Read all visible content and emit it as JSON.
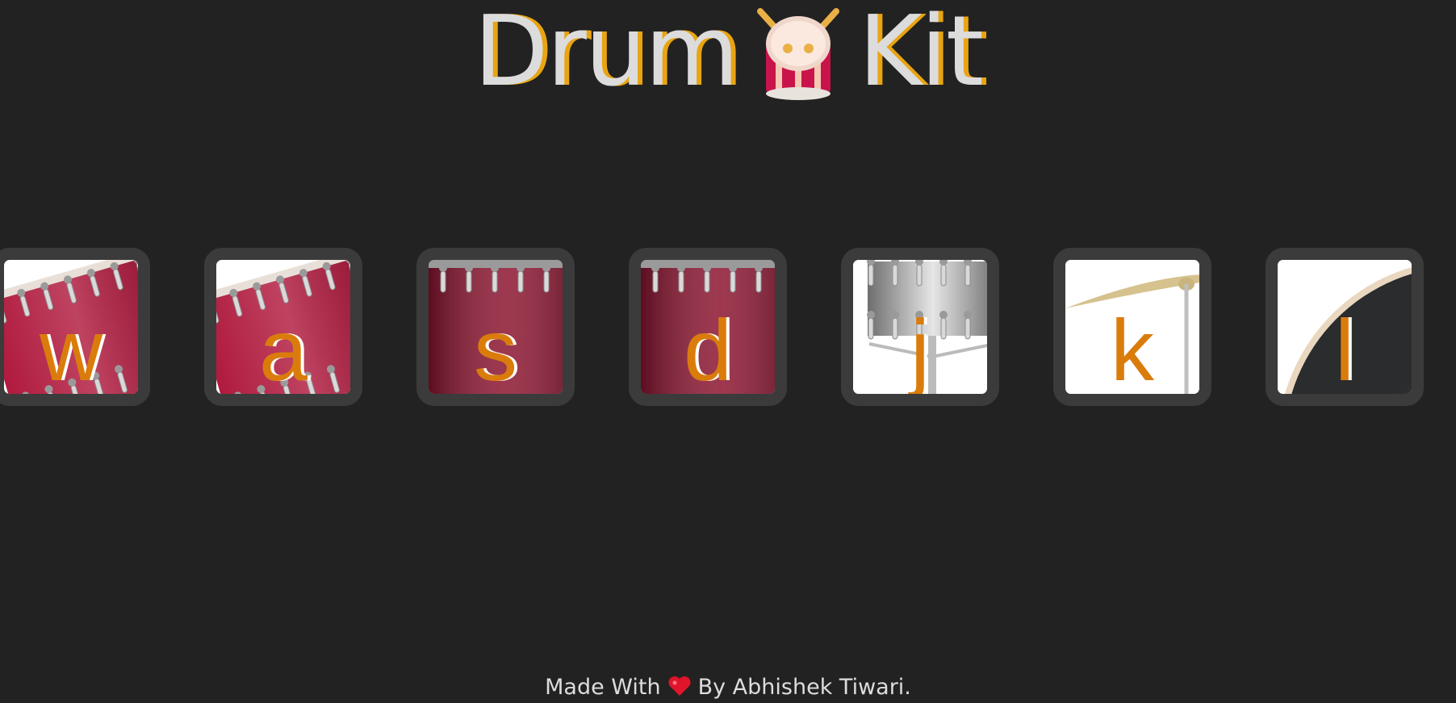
{
  "title": {
    "left_word": "Drum",
    "right_word": "Kit",
    "emoji_icon": "drum-with-sticks-icon"
  },
  "colors": {
    "background": "#222222",
    "title_text": "#dcdcdc",
    "title_shadow": "#e8a412",
    "key_letter": "#da7c0c",
    "button_border": "#3b3b3b"
  },
  "drums": [
    {
      "key": "w",
      "instrument_icon": "tom-drum-icon"
    },
    {
      "key": "a",
      "instrument_icon": "tom-drum-icon"
    },
    {
      "key": "s",
      "instrument_icon": "snare-drum-icon"
    },
    {
      "key": "d",
      "instrument_icon": "snare-drum-icon"
    },
    {
      "key": "j",
      "instrument_icon": "hi-hat-icon"
    },
    {
      "key": "k",
      "instrument_icon": "cymbal-icon"
    },
    {
      "key": "l",
      "instrument_icon": "bass-drum-icon"
    }
  ],
  "footer": {
    "made_with": "Made With",
    "heart_icon": "heart-icon",
    "by": "By Abhishek Tiwari."
  }
}
